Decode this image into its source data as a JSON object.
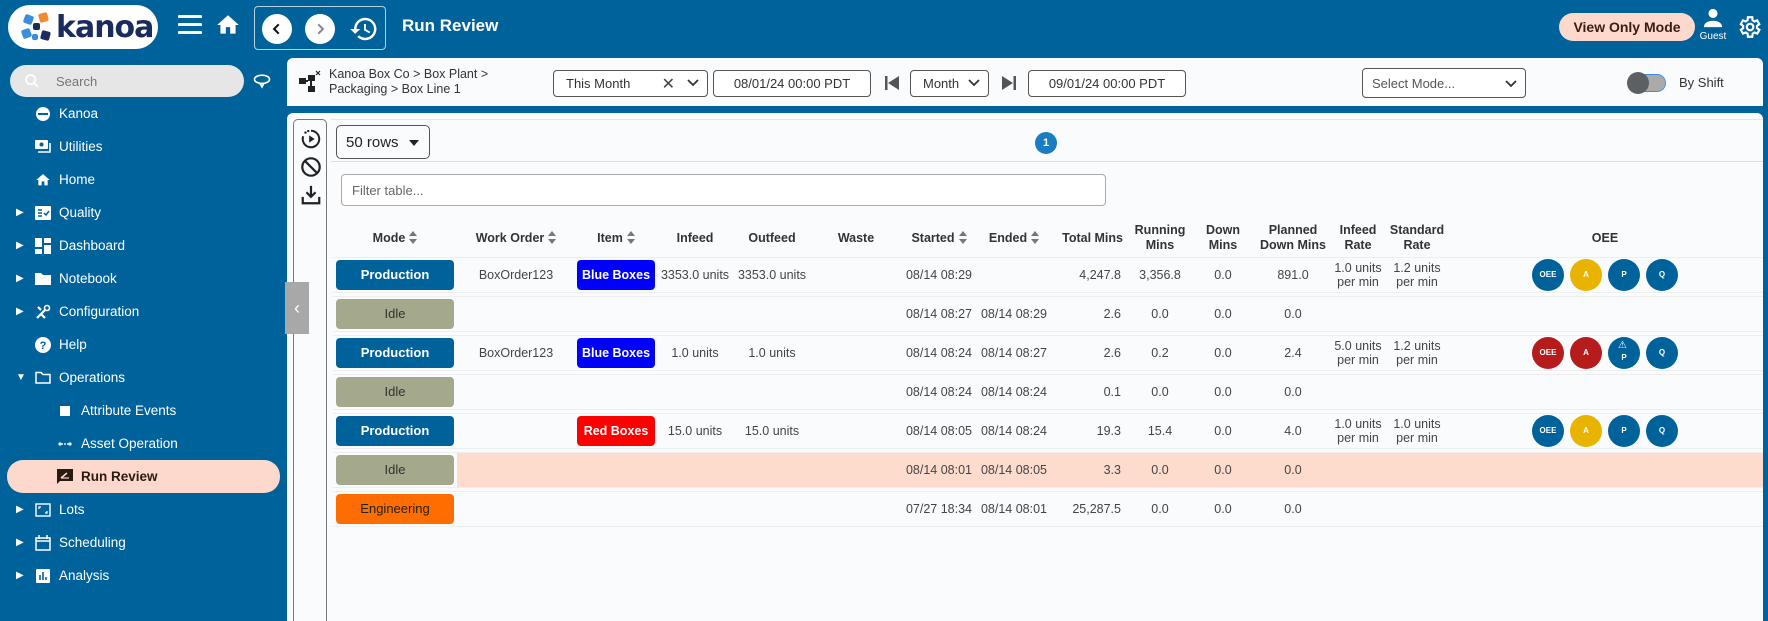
{
  "header": {
    "logo_text": "kanoa",
    "title": "Run Review",
    "view_only_label": "View Only Mode",
    "user_label": "Guest"
  },
  "sidebar": {
    "search_placeholder": "Search",
    "items": [
      {
        "label": "Kanoa",
        "icon": "kanoa-logo-icon",
        "expandable": false
      },
      {
        "label": "Utilities",
        "icon": "utilities-icon",
        "expandable": false
      },
      {
        "label": "Home",
        "icon": "home-icon",
        "expandable": false
      },
      {
        "label": "Quality",
        "icon": "quality-checklist-icon",
        "expandable": true
      },
      {
        "label": "Dashboard",
        "icon": "dashboard-icon",
        "expandable": true
      },
      {
        "label": "Notebook",
        "icon": "folder-icon",
        "expandable": true
      },
      {
        "label": "Configuration",
        "icon": "tools-icon",
        "expandable": true
      },
      {
        "label": "Help",
        "icon": "help-icon",
        "expandable": false
      },
      {
        "label": "Operations",
        "icon": "folder-open-icon",
        "expandable": true,
        "expanded": true
      },
      {
        "label": "Attribute Events",
        "icon": "square-icon",
        "sub": true
      },
      {
        "label": "Asset Operation",
        "icon": "dots-line-icon",
        "sub": true
      },
      {
        "label": "Run Review",
        "icon": "run-review-icon",
        "sub": true,
        "active": true
      },
      {
        "label": "Lots",
        "icon": "lots-icon",
        "expandable": true
      },
      {
        "label": "Scheduling",
        "icon": "calendar-icon",
        "expandable": true
      },
      {
        "label": "Analysis",
        "icon": "bar-chart-icon",
        "expandable": true
      }
    ]
  },
  "filterbar": {
    "breadcrumb_line1": "Kanoa Box Co > Box Plant >",
    "breadcrumb_line2": "Packaging > Box Line 1",
    "range_select": "This Month",
    "start_date": "08/01/24 00:00 PDT",
    "period_select": "Month",
    "end_date": "09/01/24 00:00 PDT",
    "mode_placeholder": "Select Mode...",
    "by_shift_label": "By Shift",
    "by_shift_on": false
  },
  "table": {
    "rows_per_page": "50 rows",
    "current_page": "1",
    "filter_placeholder": "Filter table...",
    "columns": [
      "Mode",
      "Work Order",
      "Item",
      "Infeed",
      "Outfeed",
      "Waste",
      "Started",
      "Ended",
      "Total Mins",
      "Running Mins",
      "Down Mins",
      "Planned Down Mins",
      "Infeed Rate",
      "Standard Rate",
      "OEE"
    ],
    "rows": [
      {
        "mode": "Production",
        "mode_color": "#00629b",
        "mode_text": "#ffffff",
        "work_order": "BoxOrder123",
        "item": "Blue Boxes",
        "item_color": "#0000ff",
        "infeed": "3353.0 units",
        "outfeed": "3353.0 units",
        "waste": "",
        "started": "08/14 08:29",
        "ended": "",
        "total_mins": "4,247.8",
        "running_mins": "3,356.8",
        "down_mins": "0.0",
        "planned_down_mins": "891.0",
        "infeed_rate_1": "1.0 units",
        "infeed_rate_2": "per min",
        "standard_rate_1": "1.2 units",
        "standard_rate_2": "per min",
        "oee": [
          {
            "label": "OEE",
            "color": "#00629b"
          },
          {
            "label": "A",
            "color": "#e8b400"
          },
          {
            "label": "P",
            "color": "#00629b"
          },
          {
            "label": "Q",
            "color": "#00629b"
          }
        ],
        "highlight": false
      },
      {
        "mode": "Idle",
        "mode_color": "#a3a98a",
        "mode_text": "#333333",
        "work_order": "",
        "item": "",
        "item_color": "",
        "infeed": "",
        "outfeed": "",
        "waste": "",
        "started": "08/14 08:27",
        "ended": "08/14 08:29",
        "total_mins": "2.6",
        "running_mins": "0.0",
        "down_mins": "0.0",
        "planned_down_mins": "0.0",
        "infeed_rate_1": "",
        "infeed_rate_2": "",
        "standard_rate_1": "",
        "standard_rate_2": "",
        "oee": [],
        "highlight": false
      },
      {
        "mode": "Production",
        "mode_color": "#00629b",
        "mode_text": "#ffffff",
        "work_order": "BoxOrder123",
        "item": "Blue Boxes",
        "item_color": "#0000ff",
        "infeed": "1.0 units",
        "outfeed": "1.0 units",
        "waste": "",
        "started": "08/14 08:24",
        "ended": "08/14 08:27",
        "total_mins": "2.6",
        "running_mins": "0.2",
        "down_mins": "0.0",
        "planned_down_mins": "2.4",
        "infeed_rate_1": "5.0 units",
        "infeed_rate_2": "per min",
        "standard_rate_1": "1.2 units",
        "standard_rate_2": "per min",
        "oee": [
          {
            "label": "OEE",
            "color": "#b71c1c"
          },
          {
            "label": "A",
            "color": "#b71c1c"
          },
          {
            "label": "P",
            "color": "#00629b",
            "warning": true
          },
          {
            "label": "Q",
            "color": "#00629b"
          }
        ],
        "highlight": false
      },
      {
        "mode": "Idle",
        "mode_color": "#a3a98a",
        "mode_text": "#333333",
        "work_order": "",
        "item": "",
        "item_color": "",
        "infeed": "",
        "outfeed": "",
        "waste": "",
        "started": "08/14 08:24",
        "ended": "08/14 08:24",
        "total_mins": "0.1",
        "running_mins": "0.0",
        "down_mins": "0.0",
        "planned_down_mins": "0.0",
        "infeed_rate_1": "",
        "infeed_rate_2": "",
        "standard_rate_1": "",
        "standard_rate_2": "",
        "oee": [],
        "highlight": false
      },
      {
        "mode": "Production",
        "mode_color": "#00629b",
        "mode_text": "#ffffff",
        "work_order": "",
        "item": "Red Boxes",
        "item_color": "#ff0000",
        "infeed": "15.0 units",
        "outfeed": "15.0 units",
        "waste": "",
        "started": "08/14 08:05",
        "ended": "08/14 08:24",
        "total_mins": "19.3",
        "running_mins": "15.4",
        "down_mins": "0.0",
        "planned_down_mins": "4.0",
        "infeed_rate_1": "1.0 units",
        "infeed_rate_2": "per min",
        "standard_rate_1": "1.0 units",
        "standard_rate_2": "per min",
        "oee": [
          {
            "label": "OEE",
            "color": "#00629b"
          },
          {
            "label": "A",
            "color": "#e8b400"
          },
          {
            "label": "P",
            "color": "#00629b"
          },
          {
            "label": "Q",
            "color": "#00629b"
          }
        ],
        "highlight": false
      },
      {
        "mode": "Idle",
        "mode_color": "#a3a98a",
        "mode_text": "#333333",
        "work_order": "",
        "item": "",
        "item_color": "",
        "infeed": "",
        "outfeed": "",
        "waste": "",
        "started": "08/14 08:01",
        "ended": "08/14 08:05",
        "total_mins": "3.3",
        "running_mins": "0.0",
        "down_mins": "0.0",
        "planned_down_mins": "0.0",
        "infeed_rate_1": "",
        "infeed_rate_2": "",
        "standard_rate_1": "",
        "standard_rate_2": "",
        "oee": [],
        "highlight": true
      },
      {
        "mode": "Engineering",
        "mode_color": "#ff6d00",
        "mode_text": "#222222",
        "work_order": "",
        "item": "",
        "item_color": "",
        "infeed": "",
        "outfeed": "",
        "waste": "",
        "started": "07/27 18:34",
        "ended": "08/14 08:01",
        "total_mins": "25,287.5",
        "running_mins": "0.0",
        "down_mins": "0.0",
        "planned_down_mins": "0.0",
        "infeed_rate_1": "",
        "infeed_rate_2": "",
        "standard_rate_1": "",
        "standard_rate_2": "",
        "oee": [],
        "highlight": false
      }
    ]
  },
  "colors": {
    "brand_blue": "#00629b",
    "active_highlight": "#fcd9cc"
  }
}
